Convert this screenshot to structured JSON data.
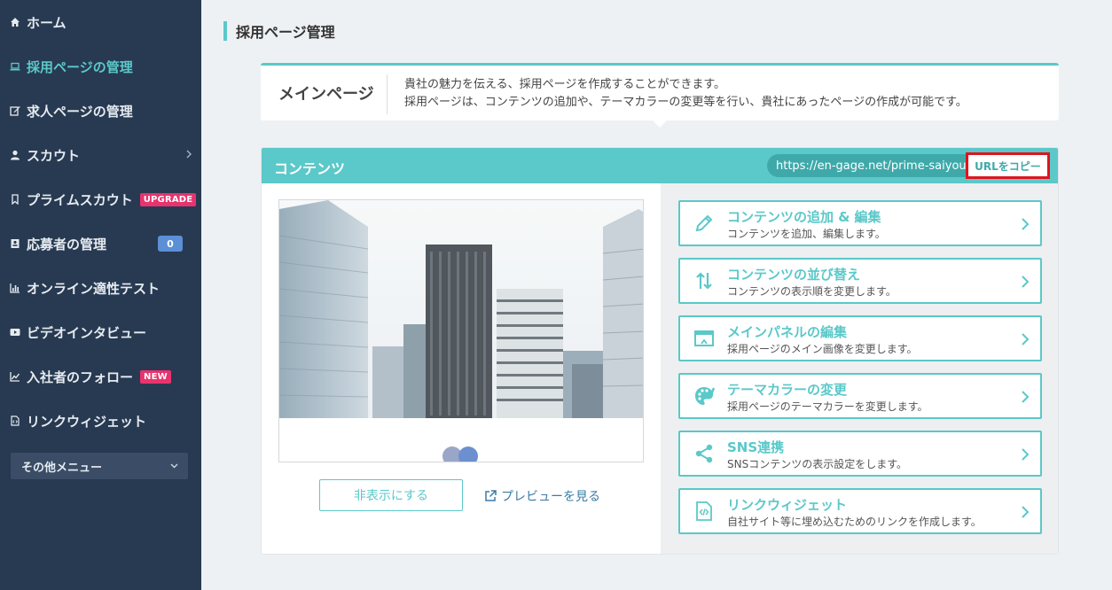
{
  "sidebar": {
    "items": [
      {
        "label": "ホーム",
        "icon": "home-icon"
      },
      {
        "label": "採用ページの管理",
        "icon": "laptop-icon"
      },
      {
        "label": "求人ページの管理",
        "icon": "edit-icon"
      },
      {
        "label": "スカウト",
        "icon": "user-icon"
      },
      {
        "label": "プライムスカウト",
        "icon": "bookmark-icon",
        "badge": "UPGRADE"
      },
      {
        "label": "応募者の管理",
        "icon": "id-card-icon",
        "count": "0"
      },
      {
        "label": "オンライン適性テスト",
        "icon": "bar-chart-icon"
      },
      {
        "label": "ビデオインタビュー",
        "icon": "video-icon"
      },
      {
        "label": "入社者のフォロー",
        "icon": "line-chart-icon",
        "badge": "NEW"
      },
      {
        "label": "リンクウィジェット",
        "icon": "code-file-icon"
      }
    ],
    "other_menu": "その他メニュー"
  },
  "page": {
    "title": "採用ページ管理"
  },
  "info": {
    "label": "メインページ",
    "line1": "貴社の魅力を伝える、採用ページを作成することができます。",
    "line2": "採用ページは、コンテンツの追加や、テーマカラーの変更等を行い、貴社にあったページの作成が可能です。"
  },
  "content": {
    "title": "コンテンツ",
    "url": "https://en-gage.net/prime-saiyou/",
    "copy_label": "URLをコピー",
    "hide_label": "非表示にする",
    "preview_label": "プレビューを見る",
    "actions": [
      {
        "title": "コンテンツの追加 & 編集",
        "desc": "コンテンツを追加、編集します。",
        "icon": "pencil-icon"
      },
      {
        "title": "コンテンツの並び替え",
        "desc": "コンテンツの表示順を変更します。",
        "icon": "sort-icon"
      },
      {
        "title": "メインパネルの編集",
        "desc": "採用ページのメイン画像を変更します。",
        "icon": "panel-icon"
      },
      {
        "title": "テーマカラーの変更",
        "desc": "採用ページのテーマカラーを変更します。",
        "icon": "palette-icon"
      },
      {
        "title": "SNS連携",
        "desc": "SNSコンテンツの表示設定をします。",
        "icon": "share-icon"
      },
      {
        "title": "リンクウィジェット",
        "desc": "自社サイト等に埋め込むためのリンクを作成します。",
        "icon": "code-file-icon"
      }
    ]
  },
  "colors": {
    "sidebar_bg": "#283a52",
    "accent": "#5bc8c9",
    "badge_pink": "#e8336e",
    "count_blue": "#5b8fd6",
    "highlight_red": "#e0141e"
  }
}
